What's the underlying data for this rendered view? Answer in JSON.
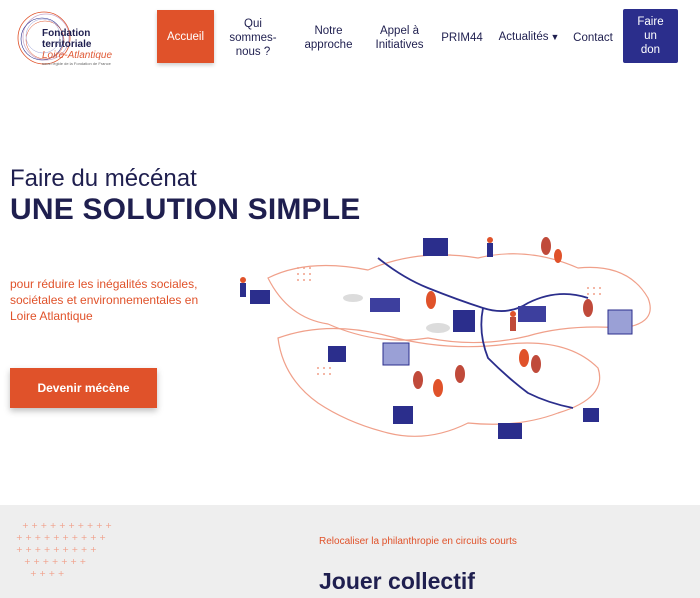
{
  "logo": {
    "line1": "Fondation",
    "line2": "territoriale",
    "line3": "Loire-Atlantique",
    "line4": "sous l'égide de la Fondation de France"
  },
  "nav": {
    "items": [
      {
        "label": "Accueil"
      },
      {
        "label": "Qui\nsommes-\nnous ?"
      },
      {
        "label": "Notre\napproche"
      },
      {
        "label": "Appel à\nInitiatives"
      },
      {
        "label": "PRIM44"
      },
      {
        "label": "Actualités"
      },
      {
        "label": "Contact"
      }
    ],
    "donate": "Faire\nun\ndon"
  },
  "hero": {
    "title_line1": "Faire du mécénat",
    "title_line2": "UNE SOLUTION SIMPLE",
    "subtitle": "pour réduire les inégalités sociales, sociétales et environnementales en Loire Atlantique",
    "cta": "Devenir mécène"
  },
  "section2": {
    "kicker": "Relocaliser la philanthropie en circuits courts",
    "title": "Jouer collectif"
  },
  "colors": {
    "accent": "#e0522a",
    "navy": "#1f1f4f",
    "donate": "#2b2e8c",
    "section_bg": "#eeeeee"
  },
  "icons": {
    "dropdown": "chevron-down-icon"
  }
}
